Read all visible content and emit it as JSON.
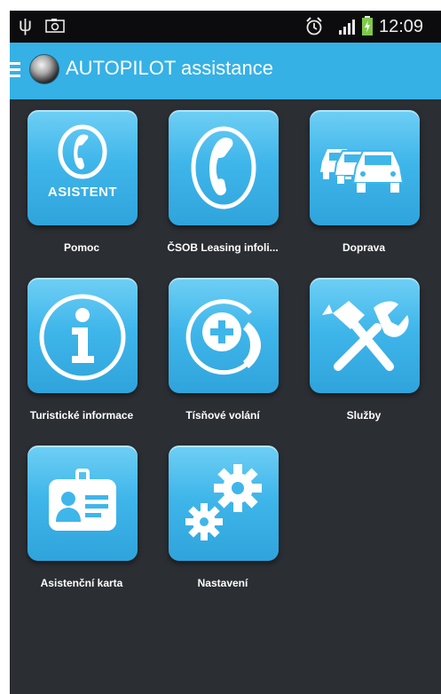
{
  "status_bar": {
    "time": "12:09",
    "icons": [
      "usb-icon",
      "screenshot-icon",
      "alarm-icon",
      "signal-icon",
      "battery-charging-icon"
    ]
  },
  "app_bar": {
    "title": "AUTOPILOT assistance",
    "icons": [
      "menu-icon",
      "app-logo-icon"
    ]
  },
  "tiles": [
    {
      "label": "Pomoc",
      "button_text": "ASISTENT",
      "icon": "phone-icon"
    },
    {
      "label": "ČSOB Leasing infoli...",
      "icon": "phone-icon"
    },
    {
      "label": "Doprava",
      "icon": "cars-traffic-icon"
    },
    {
      "label": "Turistické informace",
      "icon": "info-icon"
    },
    {
      "label": "Tísňové volání",
      "icon": "emergency-call-icon"
    },
    {
      "label": "Služby",
      "icon": "tools-icon"
    },
    {
      "label": "Asistenční karta",
      "icon": "id-card-icon"
    },
    {
      "label": "Nastavení",
      "icon": "gears-icon"
    }
  ],
  "colors": {
    "accent": "#35b1e6",
    "background": "#2b2e33",
    "status_bar": "#0c0c0e"
  }
}
